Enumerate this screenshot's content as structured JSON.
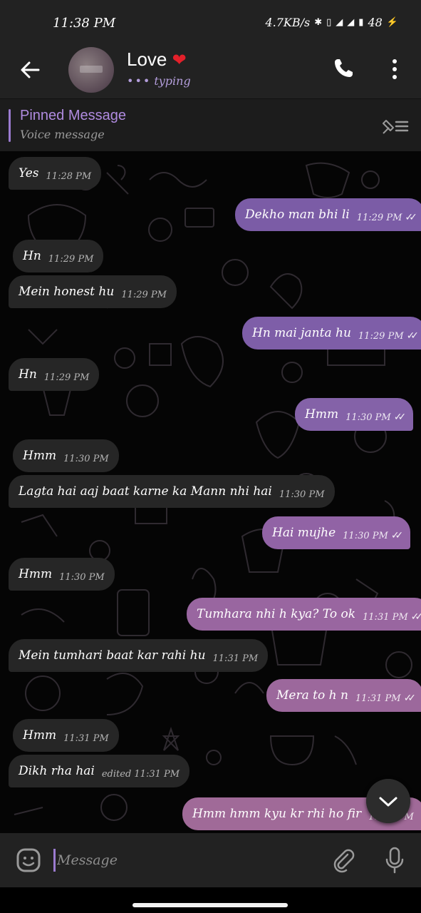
{
  "status_bar": {
    "time": "11:38 PM",
    "network_speed": "4.7KB/s",
    "battery": "48"
  },
  "header": {
    "title": "Love",
    "title_emoji": "❤️",
    "status": "typing",
    "back_icon": "arrow-left-icon",
    "call_icon": "phone-icon",
    "menu_icon": "more-vertical-icon"
  },
  "pinned": {
    "title": "Pinned Message",
    "subtitle": "Voice message",
    "icon": "unpin-icon"
  },
  "messages": [
    {
      "dir": "in",
      "text": "Yes",
      "time": "11:28 PM"
    },
    {
      "dir": "out",
      "text": "Dekho man bhi li",
      "time": "11:29 PM"
    },
    {
      "dir": "in",
      "text": "Hn",
      "time": "11:29 PM"
    },
    {
      "dir": "in",
      "text": "Mein honest hu",
      "time": "11:29 PM"
    },
    {
      "dir": "out",
      "text": "Hn mai janta hu",
      "time": "11:29 PM"
    },
    {
      "dir": "in",
      "text": "Hn",
      "time": "11:29 PM"
    },
    {
      "dir": "out",
      "text": "Hmm",
      "time": "11:30 PM"
    },
    {
      "dir": "in",
      "text": "Hmm",
      "time": "11:30 PM"
    },
    {
      "dir": "in",
      "text": "Lagta hai aaj baat karne ka Mann nhi hai",
      "time": "11:30 PM"
    },
    {
      "dir": "out",
      "text": "Hai mujhe",
      "time": "11:30 PM"
    },
    {
      "dir": "in",
      "text": "Hmm",
      "time": "11:30 PM"
    },
    {
      "dir": "out",
      "text": "Tumhara nhi h kya? To ok",
      "time": "11:31 PM"
    },
    {
      "dir": "in",
      "text": "Mein tumhari baat kar rahi hu",
      "time": "11:31 PM"
    },
    {
      "dir": "out",
      "text": "Mera to h n",
      "time": "11:31 PM"
    },
    {
      "dir": "in",
      "text": "Hmm",
      "time": "11:31 PM"
    },
    {
      "dir": "in",
      "text": "Dikh rha hai",
      "time": "edited 11:31 PM"
    },
    {
      "dir": "out",
      "text": "Hmm hmm kyu kr rhi ho fir",
      "time": "11:32 PM"
    }
  ],
  "input": {
    "placeholder": "Message",
    "emoji_icon": "emoji-icon",
    "attach_icon": "paperclip-icon",
    "mic_icon": "microphone-icon"
  },
  "colors": {
    "header_bg": "#222222",
    "incoming_bubble": "#262626",
    "outgoing_bubble_purple": "#7b5ca6",
    "outgoing_bubble_pink": "#a06a98",
    "accent": "#b08be0"
  }
}
